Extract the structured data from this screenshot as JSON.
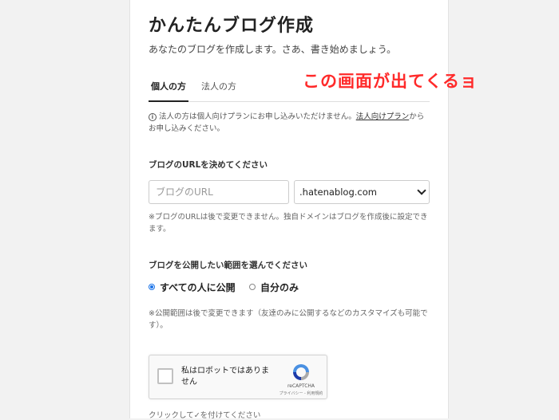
{
  "header": {
    "title": "かんたんブログ作成",
    "subtitle": "あなたのブログを作成します。さあ、書き始めましょう。"
  },
  "tabs": [
    {
      "label": "個人の方",
      "active": true
    },
    {
      "label": "法人の方",
      "active": false
    }
  ],
  "annotation": "この画面が出てくるョ",
  "notice": {
    "icon": "info-icon",
    "before": "法人の方は個人向けプランにお申し込みいただけません。",
    "link": "法人向けプラン",
    "after": "からお申し込みください。"
  },
  "url_section": {
    "label": "ブログのURLを決めてください",
    "input_placeholder": "ブログのURL",
    "domain_selected": ".hatenablog.com",
    "note": "※ブログのURLは後で変更できません。独自ドメインはブログを作成後に設定できます。"
  },
  "visibility_section": {
    "label": "ブログを公開したい範囲を選んでください",
    "options": [
      {
        "label": "すべての人に公開",
        "checked": true
      },
      {
        "label": "自分のみ",
        "checked": false
      }
    ],
    "note": "※公開範囲は後で変更できます（友達のみに公開するなどのカスタマイズも可能です）。"
  },
  "recaptcha": {
    "label": "私はロボットではありません",
    "brand": "reCAPTCHA",
    "terms": "プライバシー - 利用規約"
  },
  "hint": "クリックして✓を付けてください",
  "colors": {
    "accent": "#1a73e8",
    "annotation": "#ff2a2a",
    "background": "#f2f2f2"
  }
}
